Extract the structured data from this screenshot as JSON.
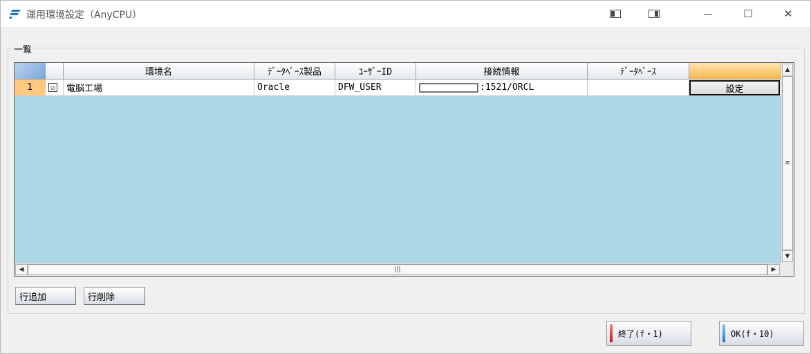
{
  "window": {
    "title": "運用環境設定（AnyCPU）",
    "controls": {
      "minimize": "—",
      "maximize": "☐",
      "close": "✕"
    }
  },
  "group": {
    "label": "一覧"
  },
  "grid": {
    "columns": [
      "環境名",
      "ﾃﾞｰﾀﾍﾞｰｽ製品",
      "ﾕｰｻﾞｰID",
      "接続情報",
      "ﾃﾞｰﾀﾍﾞｰｽ",
      ""
    ],
    "rows": [
      {
        "row_number": "1",
        "checked": "☑",
        "environment_name": "電脳工場",
        "db_product": "Oracle",
        "user_id": "DFW_USER",
        "connection_suffix": ":1521/ORCL",
        "database": "",
        "action_label": "設定"
      }
    ]
  },
  "buttons": {
    "add_row": "行追加",
    "delete_row": "行削除",
    "exit": "終了(f・1)",
    "ok": "OK(f・10)"
  },
  "colors": {
    "grid_background": "#add8e6",
    "row_header_accent": "#ffc982",
    "exit_accent": "#d92c2c",
    "ok_accent": "#2c8fd9"
  }
}
